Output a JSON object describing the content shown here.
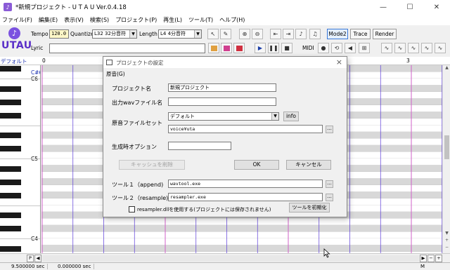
{
  "window": {
    "title": "*新規プロジェクト - U T A U Ver.0.4.18",
    "minimize_glyph": "—",
    "maximize_glyph": "☐",
    "close_glyph": "✕"
  },
  "menu": [
    "ファイル(F)",
    "編集(E)",
    "表示(V)",
    "検索(S)",
    "プロジェクト(P)",
    "再生(L)",
    "ツール(T)",
    "ヘルプ(H)"
  ],
  "toolbar": {
    "logo_text": "UTAU",
    "tempo_label": "Tempo",
    "tempo_value": "120.0",
    "quantize_label": "Quantize",
    "quantize_value": "L32 32分音符",
    "length_label": "Length",
    "length_value": "L4 4分音符",
    "lyric_label": "Lyric",
    "lyric_value": "",
    "mode2_label": "Mode2",
    "trace_label": "Trace",
    "render_label": "Render",
    "midi_label": "MIDI",
    "icons": [
      "pointer-icon",
      "pencil-icon",
      "zoom-in-icon",
      "zoom-out-icon",
      "jump-start-icon",
      "jump-end-icon",
      "split-note-icon",
      "merge-note-icon"
    ]
  },
  "pianoroll": {
    "track_label": "デフォルト",
    "measure_start": "0",
    "measure_end": "3",
    "key_labels": [
      "C#6",
      "C6",
      "C5",
      "C4"
    ]
  },
  "status": {
    "time1": "9.500000 sec",
    "time2": "0.000000 sec",
    "mode": "M",
    "scroll_label_p": "P"
  },
  "dialog": {
    "title": "プロジェクトの設定",
    "menu": "原音(G)",
    "project_name_label": "プロジェクト名",
    "project_name_value": "新規プロジェクト",
    "output_wav_label": "出力wavファイル名",
    "output_wav_value": "",
    "voicebank_label": "原音ファイルセット",
    "voicebank_select": "デフォルト",
    "info_label": "info",
    "voicebank_path": "voice¥uta",
    "browse_label": "...",
    "gen_options_label": "生成時オプション",
    "gen_options_value": "",
    "clear_cache_label": "キャッシュを削除",
    "ok_label": "OK",
    "cancel_label": "キャンセル",
    "tool1_label": "ツール１（append)",
    "tool1_value": "wavtool.exe",
    "tool2_label": "ツール２（resample)",
    "tool2_value": "resampler.exe",
    "checkbox_label": "resampler.dllを使用する(プロジェクトには保存されません)",
    "reset_tools_label": "ツールを初期化"
  },
  "colors": {
    "accent_purple": "#7b52e0",
    "key_blue": "#1a2fb0",
    "beat_line": "#5a3ad8",
    "measure_line": "#d060c8"
  }
}
